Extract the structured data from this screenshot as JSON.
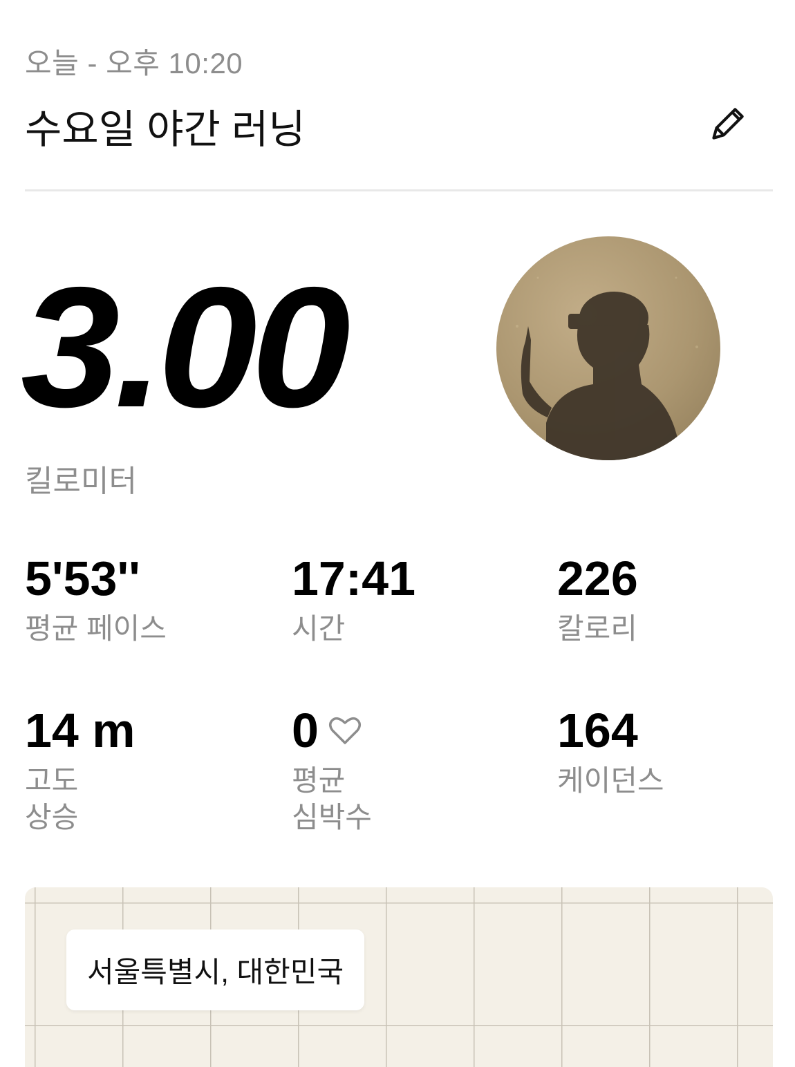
{
  "header": {
    "timestamp": "오늘 - 오후 10:20",
    "title": "수요일 야간 러닝",
    "edit_icon": "pencil-icon"
  },
  "summary": {
    "distance": "3.00",
    "distance_unit": "킬로미터"
  },
  "stats": [
    {
      "value": "5'53''",
      "label": "평균 페이스"
    },
    {
      "value": "17:41",
      "label": "시간"
    },
    {
      "value": "226",
      "label": "칼로리"
    },
    {
      "value": "14 m",
      "label": "고도\n상승"
    },
    {
      "value": "0",
      "label": "평균\n심박수",
      "icon": "heart-outline-icon"
    },
    {
      "value": "164",
      "label": "케이던스"
    }
  ],
  "map": {
    "location": "서울특별시, 대한민국"
  }
}
